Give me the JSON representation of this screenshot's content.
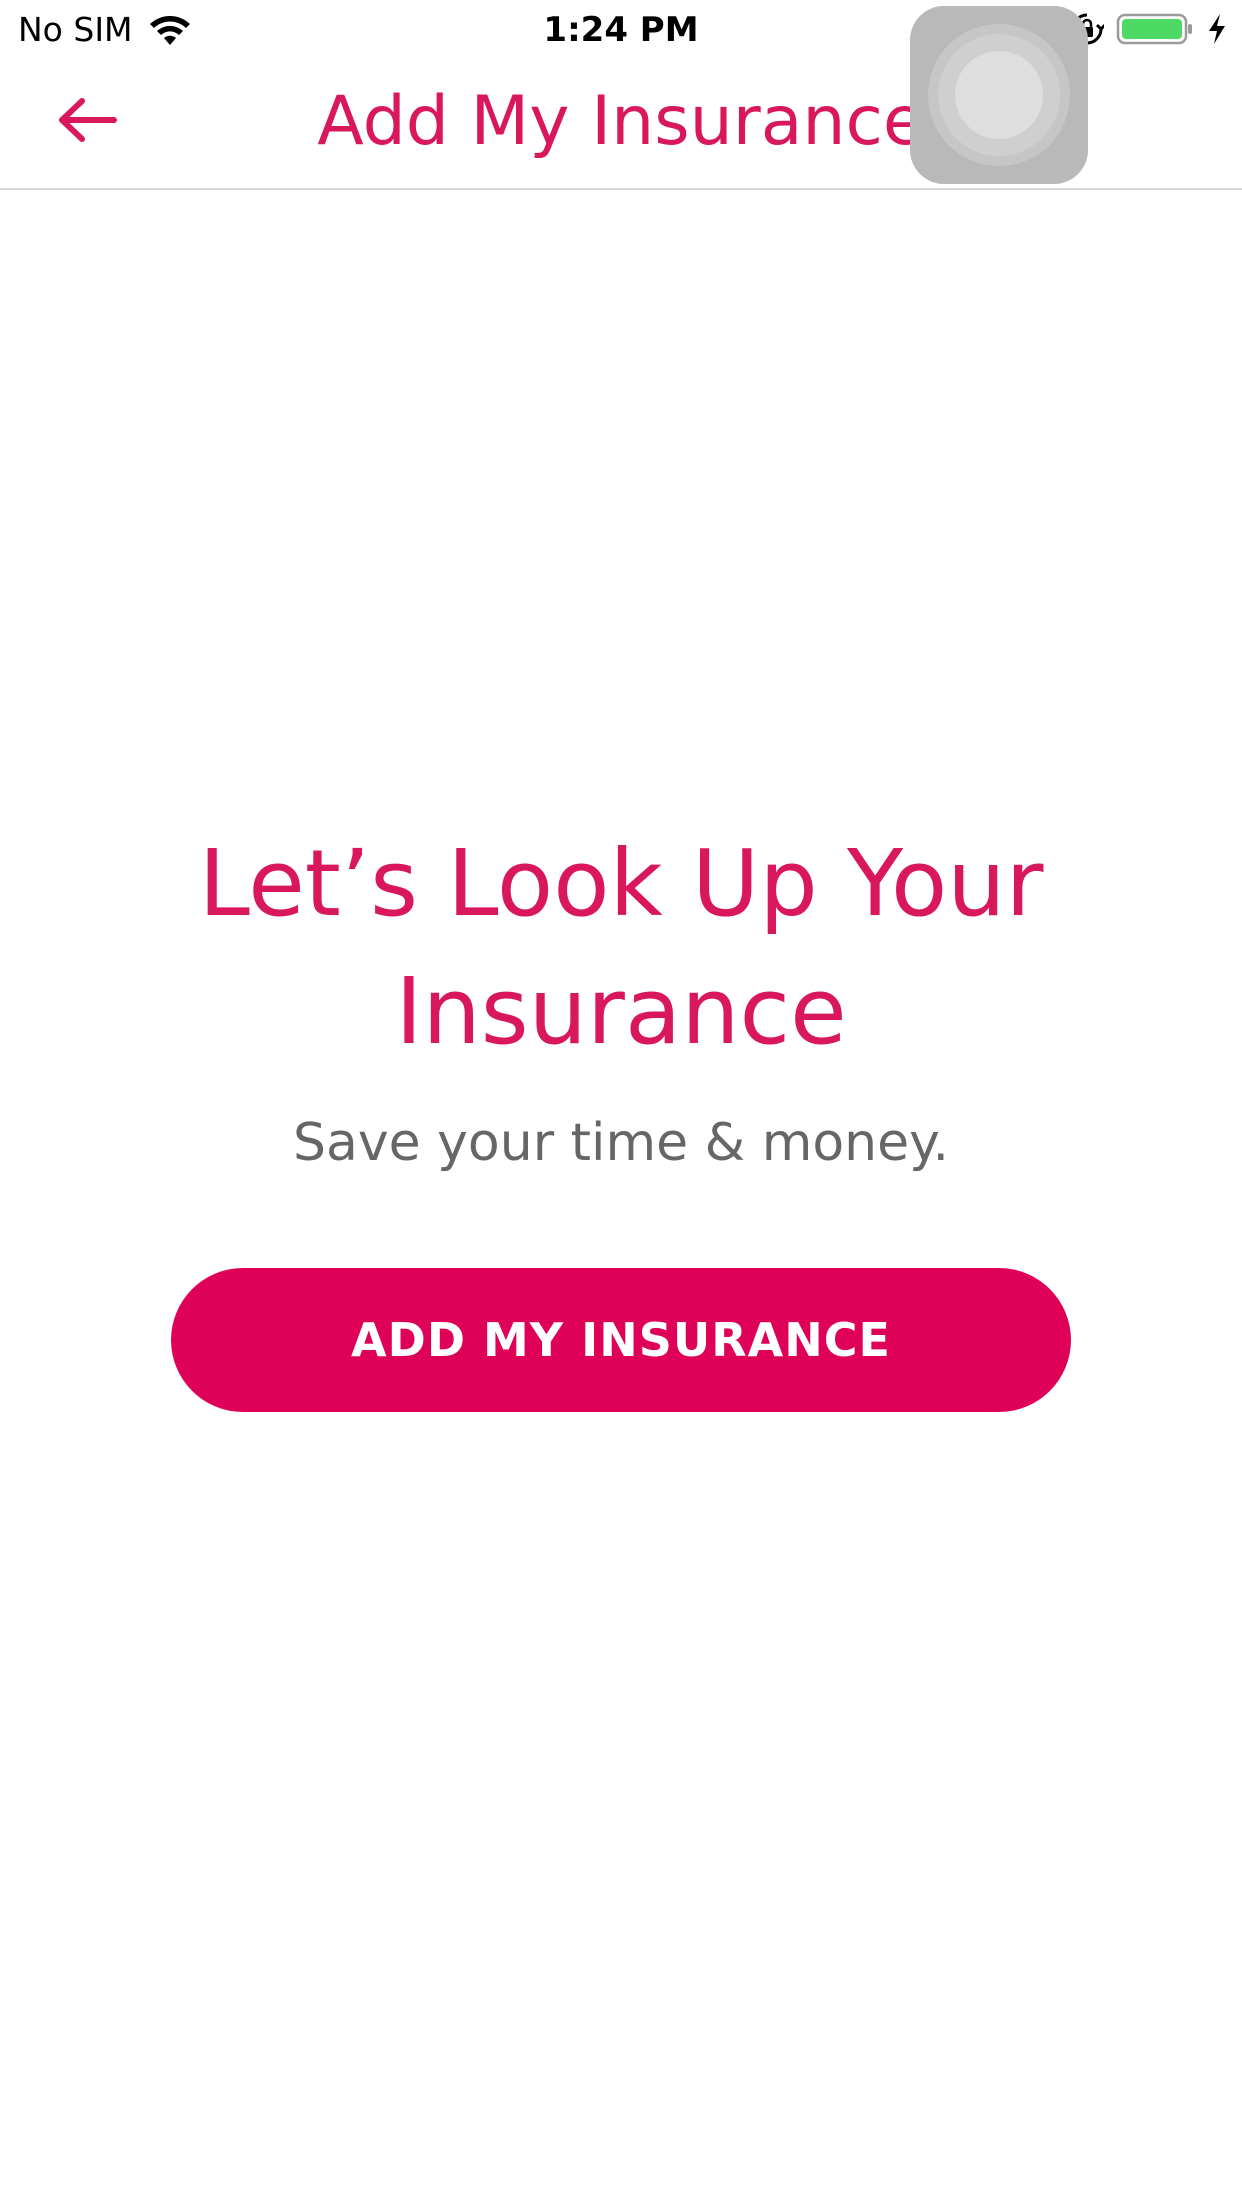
{
  "status_bar": {
    "carrier": "No SIM",
    "time": "1:24 PM",
    "icons": [
      "wifi-icon",
      "rotation-lock-icon",
      "battery-icon",
      "charging-icon"
    ],
    "battery_color": "#4cd964"
  },
  "nav": {
    "title": "Add My Insurance",
    "back_icon": "back-arrow-icon"
  },
  "overlay": {
    "name": "assistive-touch-button"
  },
  "main": {
    "headline": "Let’s Look Up Your Insurance",
    "subtitle": "Save your time & money.",
    "button_label": "ADD MY INSURANCE"
  },
  "colors": {
    "accent": "#d8175d",
    "button": "#df0058",
    "subtitle": "#666666",
    "divider": "#d9d9d9"
  }
}
